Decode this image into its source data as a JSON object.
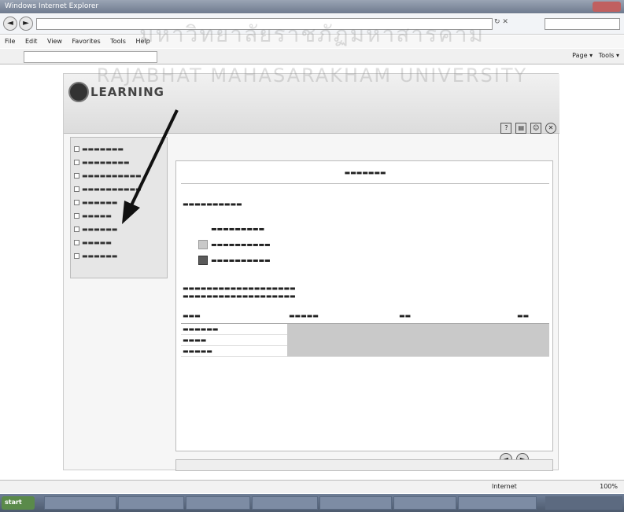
{
  "browser": {
    "title": "Windows Internet Explorer",
    "menu": [
      "File",
      "Edit",
      "View",
      "Favorites",
      "Tools",
      "Help"
    ],
    "favorites_tools": [
      "Page",
      "Tools"
    ],
    "zoom": "100%",
    "zone": "Internet"
  },
  "watermark": {
    "line1": "มหาวิทยาลัยราชภัฏมหาสารคาม",
    "line2": "RAJABHAT MAHASARAKHAM UNIVERSITY"
  },
  "app": {
    "logo": "LEARNING"
  },
  "legend": {
    "items": [
      {
        "color": "#ffffff"
      },
      {
        "color": "#c9c9c9"
      },
      {
        "color": "#5a5a5a"
      }
    ]
  },
  "pager": {
    "prev": "◄",
    "next": "►"
  },
  "taskbar": {
    "start": "start",
    "tasks": [
      "",
      "",
      "",
      "",
      "",
      "",
      ""
    ]
  },
  "icons": {
    "back": "back-arrow-icon",
    "forward": "forward-arrow-icon",
    "logo": "learning-logo-icon",
    "toolbar": [
      "help-icon",
      "document-icon",
      "people-icon",
      "logout-icon"
    ]
  }
}
